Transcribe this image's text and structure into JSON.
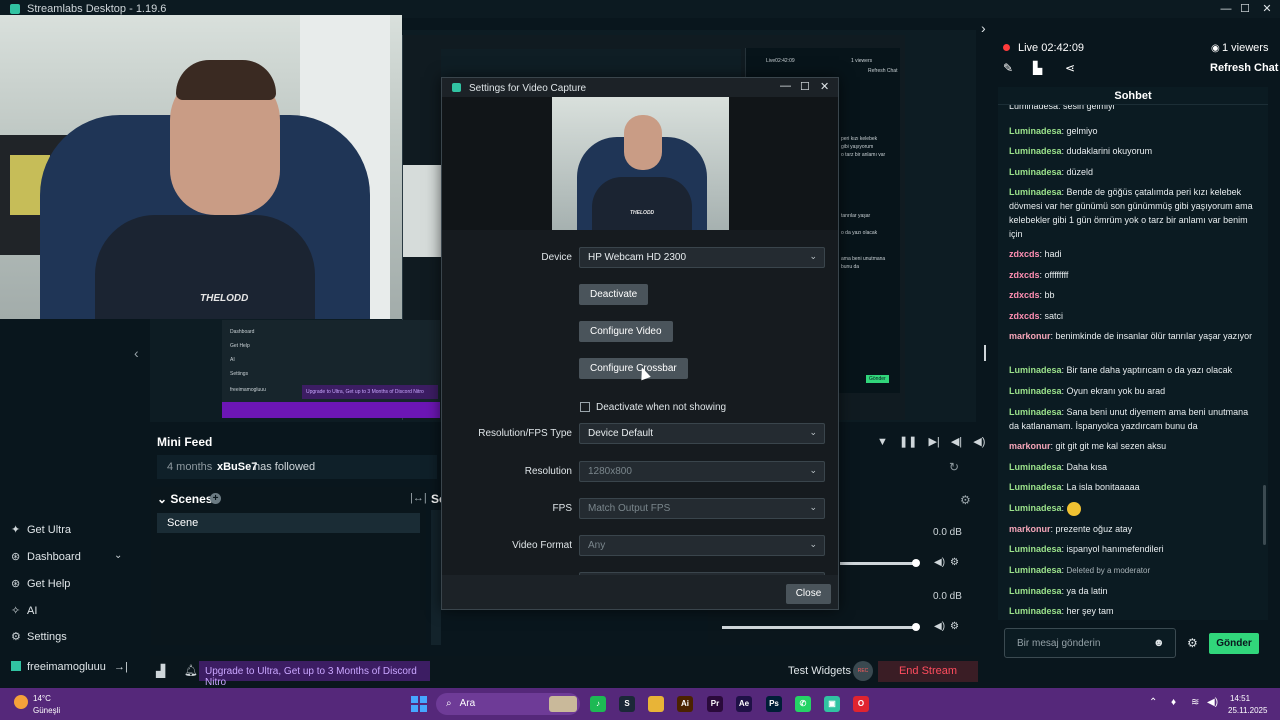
{
  "app": {
    "title": "Streamlabs Desktop - 1.19.6",
    "minimize": "—",
    "maximize": "☐",
    "close": "✕"
  },
  "webcam": {
    "logo_text": "THELODD"
  },
  "background_preview": {
    "viewers_small": "1 viewers",
    "live_small": "Live02:42:09",
    "refresh_small": "Refresh Chat",
    "snippets": [
      "peri kızı kelebek",
      "gibi yaşıyorum",
      "o tarz bir anlamı var",
      "tanrılar yaşar",
      "o da yazı olacak",
      "ama beni unutmana",
      "bunu da"
    ],
    "mini_nav": [
      "Dashboard",
      "Get Help",
      "AI",
      "Settings",
      "freeimamogluuu"
    ],
    "mini_banner": "Upgrade to Ultra, Get up to 3 Months of Discord Nitro",
    "mini_stop": "Gönder"
  },
  "minifeed": {
    "title": "Mini Feed",
    "time": "4 months",
    "user": "xBuSe7",
    "action": "has followed"
  },
  "scenes": {
    "title": "Scenes",
    "add": "+",
    "items": [
      "Scene"
    ],
    "sources_title": "So"
  },
  "mixer": {
    "db1": "0.0 dB",
    "db2": "0.0 dB",
    "level1": 1.0,
    "level2": 1.0
  },
  "nav": {
    "items": [
      {
        "label": "Get Ultra",
        "icon": "ultra-icon"
      },
      {
        "label": "Dashboard",
        "icon": "dashboard-icon"
      },
      {
        "label": "Get Help",
        "icon": "help-icon"
      },
      {
        "label": "AI",
        "icon": "ai-icon"
      },
      {
        "label": "Settings",
        "icon": "gear-icon"
      }
    ],
    "user": "freeimamogluuu"
  },
  "footer": {
    "upgrade": "Upgrade to Ultra, Get up to 3 Months of Discord Nitro",
    "test_widgets": "Test Widgets",
    "rec": "REC",
    "end_stream": "End Stream"
  },
  "chat": {
    "live_text": "Live 02:42:09",
    "viewers": "1 viewers",
    "refresh": "Refresh Chat",
    "title": "Sohbet",
    "input_placeholder": "Bir mesaj gönderin",
    "send": "Gönder",
    "messages": [
      {
        "nick": "Luminadesa",
        "color": "#9be28b",
        "text": "gelmiyo"
      },
      {
        "nick": "Luminadesa",
        "color": "#9be28b",
        "text": "dudaklarini okuyorum"
      },
      {
        "nick": "Luminadesa",
        "color": "#9be28b",
        "text": "düzeld"
      },
      {
        "nick": "Luminadesa",
        "color": "#9be28b",
        "text": "Bende de göğüs çatalımda peri kızı kelebek dövmesi var her günümü son günümmüş gibi yaşıyorum ama kelebekler gibi 1 gün ömrüm yok o tarz bir anlamı var benim için"
      },
      {
        "nick": "zdxcds",
        "color": "#ff8fb3",
        "text": "hadi"
      },
      {
        "nick": "zdxcds",
        "color": "#ff8fb3",
        "text": "offffffff"
      },
      {
        "nick": "zdxcds",
        "color": "#ff8fb3",
        "text": "bb"
      },
      {
        "nick": "zdxcds",
        "color": "#ff8fb3",
        "text": "satci"
      },
      {
        "nick": "markonur",
        "color": "#f4a5b8",
        "text": "benimkinde de insanlar ölür tanrılar yaşar yazıyor"
      },
      {
        "nick": "Luminadesa",
        "color": "#9be28b",
        "text": "Bir tane daha yaptırıcam o da yazı olacak"
      },
      {
        "nick": "Luminadesa",
        "color": "#9be28b",
        "text": "Oyun ekranı yok bu arad"
      },
      {
        "nick": "Luminadesa",
        "color": "#9be28b",
        "text": "Sana beni unut diyemem ama beni unutmana da katlanamam. İspanyolca yazdırcam bunu da"
      },
      {
        "nick": "markonur",
        "color": "#f4a5b8",
        "text": "git git git me kal sezen aksu"
      },
      {
        "nick": "Luminadesa",
        "color": "#9be28b",
        "text": "Daha kısa"
      },
      {
        "nick": "Luminadesa",
        "color": "#9be28b",
        "text": "La isla bonitaaaaa"
      },
      {
        "nick": "Luminadesa",
        "color": "#9be28b",
        "text": ""
      },
      {
        "nick": "markonur",
        "color": "#f4a5b8",
        "text": "prezente oğuz atay"
      },
      {
        "nick": "Luminadesa",
        "color": "#9be28b",
        "text": "ispanyol hanımefendileri"
      },
      {
        "nick": "Luminadesa",
        "color": "#9be28b",
        "text": "Deleted by a moderator"
      },
      {
        "nick": "Luminadesa",
        "color": "#9be28b",
        "text": "ya da latin"
      },
      {
        "nick": "Luminadesa",
        "color": "#9be28b",
        "text": "her şey tam"
      }
    ],
    "top_partial": "Luminadesa: sesin gelmiyi"
  },
  "dialog": {
    "title": "Settings for Video Capture",
    "preview_logo": "THELODD",
    "device_label": "Device",
    "device_value": "HP Webcam HD 2300",
    "deactivate": "Deactivate",
    "configure_video": "Configure Video",
    "configure_crossbar": "Configure Crossbar",
    "deactivate_when": "Deactivate when not showing",
    "res_fps_type_label": "Resolution/FPS Type",
    "res_fps_type_value": "Device Default",
    "resolution_label": "Resolution",
    "resolution_value": "1280x800",
    "fps_label": "FPS",
    "fps_value": "Match Output FPS",
    "video_format_label": "Video Format",
    "video_format_value": "Any",
    "close": "Close"
  },
  "taskbar": {
    "temp": "14°C",
    "weather": "Güneşli",
    "search": "Ara",
    "time": "14:51",
    "date": "25.11.2025",
    "apps": [
      {
        "name": "Spotify",
        "color": "#1db954",
        "glyph": "♪"
      },
      {
        "name": "Steam",
        "color": "#1b2838",
        "glyph": "S"
      },
      {
        "name": "Files",
        "color": "#e8b437",
        "glyph": ""
      },
      {
        "name": "Illustrator",
        "color": "#4b2200",
        "glyph": "Ai"
      },
      {
        "name": "Premiere",
        "color": "#2a0a3a",
        "glyph": "Pr"
      },
      {
        "name": "After Effects",
        "color": "#1f1146",
        "glyph": "Ae"
      },
      {
        "name": "Photoshop",
        "color": "#001e36",
        "glyph": "Ps"
      },
      {
        "name": "WhatsApp",
        "color": "#25d366",
        "glyph": "✆"
      },
      {
        "name": "Streamlabs",
        "color": "#31c3a2",
        "glyph": "▣"
      },
      {
        "name": "Opera",
        "color": "#e0242f",
        "glyph": "O"
      }
    ]
  }
}
